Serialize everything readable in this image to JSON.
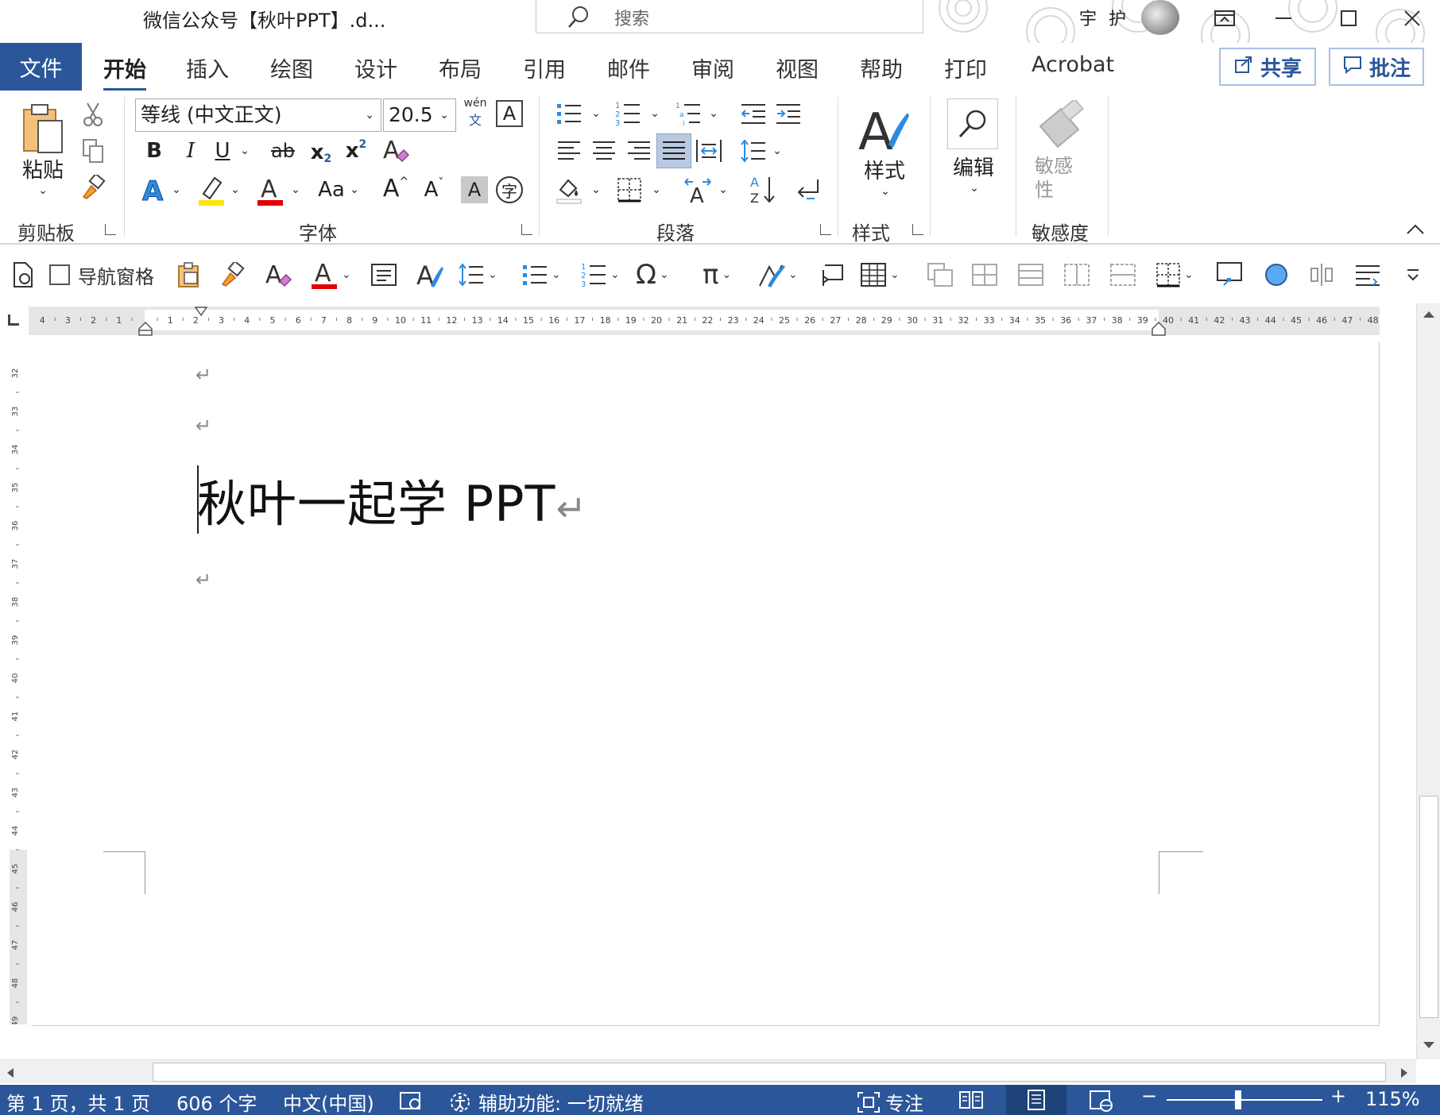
{
  "window": {
    "title": "微信公众号【秋叶PPT】.d...",
    "search_placeholder": "搜索",
    "user_name": "宇 护"
  },
  "ribbon_tabs": [
    {
      "label": "文件"
    },
    {
      "label": "开始"
    },
    {
      "label": "插入"
    },
    {
      "label": "绘图"
    },
    {
      "label": "设计"
    },
    {
      "label": "布局"
    },
    {
      "label": "引用"
    },
    {
      "label": "邮件"
    },
    {
      "label": "审阅"
    },
    {
      "label": "视图"
    },
    {
      "label": "帮助"
    },
    {
      "label": "打印"
    },
    {
      "label": "Acrobat"
    }
  ],
  "share_label": "共享",
  "comment_label": "批注",
  "ribbon": {
    "clipboard": {
      "paste": "粘贴",
      "group_label": "剪贴板"
    },
    "font": {
      "font_name": "等线 (中文正文)",
      "font_size": "20.5",
      "group_label": "字体",
      "phonetic": "wén",
      "phonetic_char": "文",
      "bold": "B",
      "italic": "I",
      "underline": "U",
      "strike": "ab",
      "subscript": "x",
      "superscript": "x",
      "case": "Aa",
      "grow": "A",
      "shrink": "A",
      "shading": "A",
      "enclose": "字"
    },
    "paragraph": {
      "group_label": "段落"
    },
    "styles": {
      "label": "样式",
      "group_label": "样式"
    },
    "editing": {
      "label": "编辑"
    },
    "sensitivity": {
      "label": "敏感性",
      "group_label": "敏感度"
    }
  },
  "quick_toolbar": {
    "nav_pane_label": "导航窗格",
    "nav_pane_checked": false
  },
  "ruler": {
    "left_numbers": [
      "4",
      "3",
      "2",
      "1"
    ],
    "right_numbers": [
      "1",
      "2",
      "3",
      "4",
      "5",
      "6",
      "7",
      "8",
      "9",
      "10",
      "11",
      "12",
      "13",
      "14",
      "15",
      "16",
      "17",
      "18",
      "19",
      "20",
      "21",
      "22",
      "23",
      "24",
      "25",
      "26",
      "27",
      "28",
      "29",
      "30",
      "31",
      "32",
      "33",
      "34",
      "35",
      "36",
      "37",
      "38",
      "39",
      "40",
      "41",
      "42",
      "43",
      "44",
      "45",
      "46",
      "47",
      "48"
    ],
    "vertical_numbers": [
      "32",
      "33",
      "34",
      "35",
      "36",
      "37",
      "38",
      "39",
      "40",
      "41",
      "42",
      "43",
      "44",
      "45",
      "46",
      "47",
      "48",
      "49"
    ]
  },
  "document": {
    "line_text": "秋叶一起学 PPT",
    "para_mark": "↵"
  },
  "statusbar": {
    "page": "第 1 页，共 1 页",
    "words": "606 个字",
    "language": "中文(中国)",
    "accessibility": "辅助功能: 一切就绪",
    "focus": "专注",
    "zoom": "115%",
    "zoom_fraction": 0.46
  },
  "colors": {
    "accent": "#2b579a",
    "font_color": "#e00000",
    "highlight": "#ffe600"
  }
}
